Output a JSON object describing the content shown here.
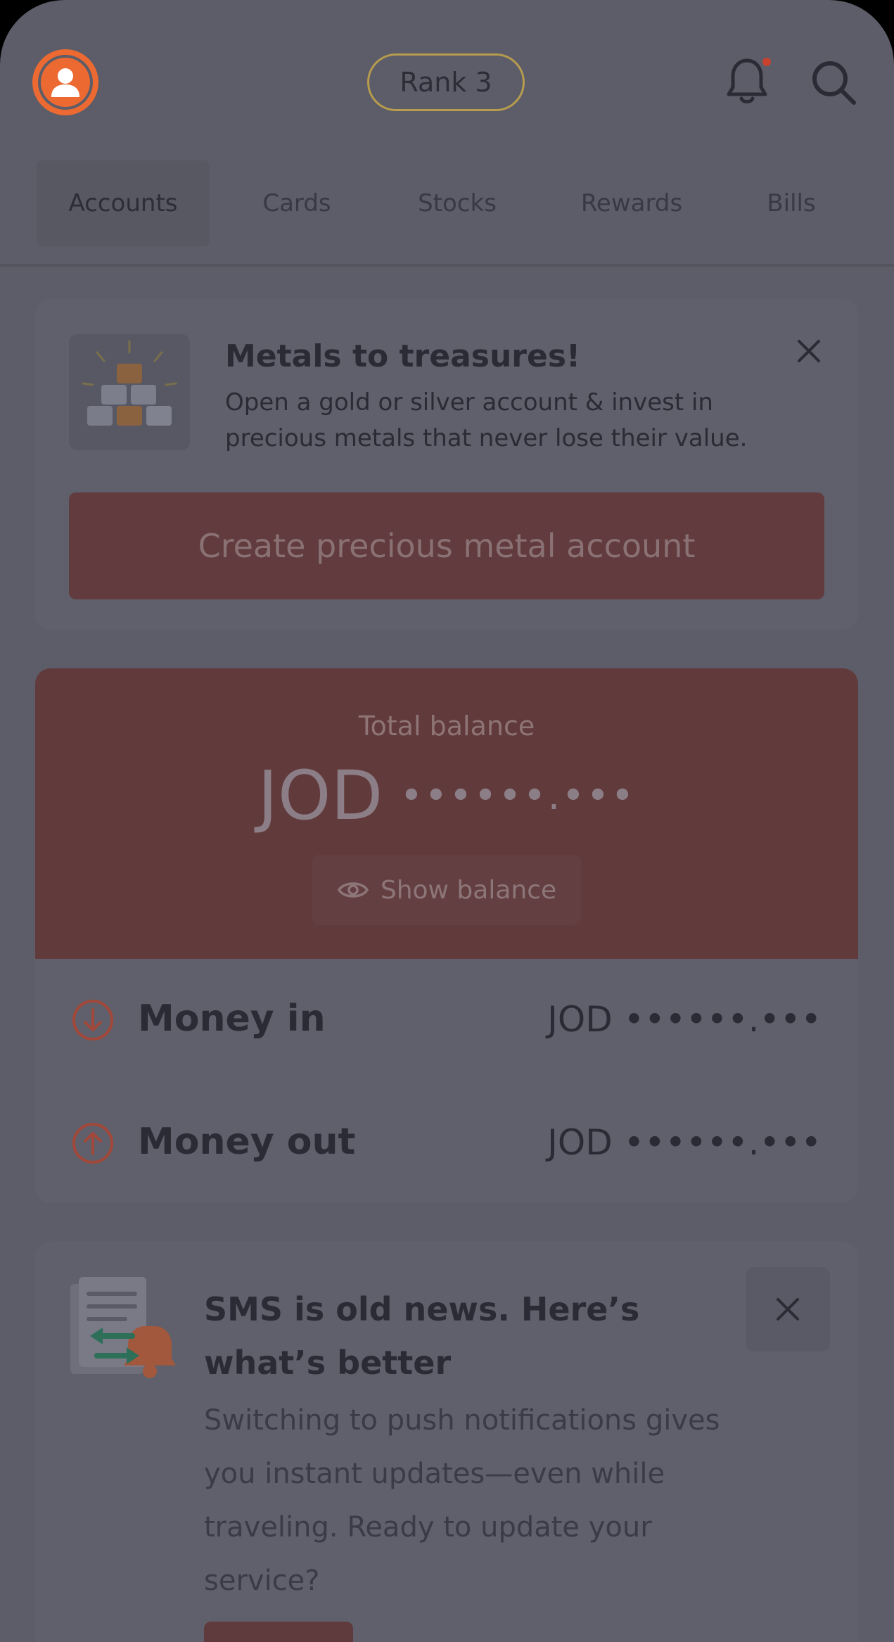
{
  "header": {
    "rank_label": "Rank 3",
    "notification_dot_color": "#c8422f",
    "icons": {
      "avatar": "user-avatar-icon",
      "notifications": "bell-icon",
      "search": "search-icon"
    }
  },
  "tabs": [
    {
      "label": "Accounts",
      "active": true
    },
    {
      "label": "Cards",
      "active": false
    },
    {
      "label": "Stocks",
      "active": false
    },
    {
      "label": "Rewards",
      "active": false
    },
    {
      "label": "Bills",
      "active": false
    }
  ],
  "metals_banner": {
    "title": "Metals to treasures!",
    "description": "Open a gold or silver account & invest in precious metals that never lose their value.",
    "cta_label": "Create precious metal account",
    "image_icon": "gold-bars-icon",
    "close_icon": "close-icon"
  },
  "balance": {
    "label": "Total balance",
    "currency": "JOD",
    "masked_value": "••••••.•••",
    "show_balance_label": "Show balance",
    "show_icon": "eye-icon"
  },
  "flows": {
    "money_in": {
      "label": "Money in",
      "value": "JOD ••••••.•••",
      "icon": "arrow-down-circle-icon"
    },
    "money_out": {
      "label": "Money out",
      "value": "JOD ••••••.•••",
      "icon": "arrow-up-circle-icon"
    }
  },
  "sms_banner": {
    "title": "SMS is old news. Here’s what’s better",
    "description": "Switching to push notifications gives you instant updates—even while traveling. Ready to update your service?",
    "image_icon": "sms-to-push-icon",
    "close_icon": "close-icon"
  },
  "colors": {
    "accent": "#ec6a32",
    "overlay_background": "#5c5d68",
    "cta_dimmed": "#613b3e"
  }
}
